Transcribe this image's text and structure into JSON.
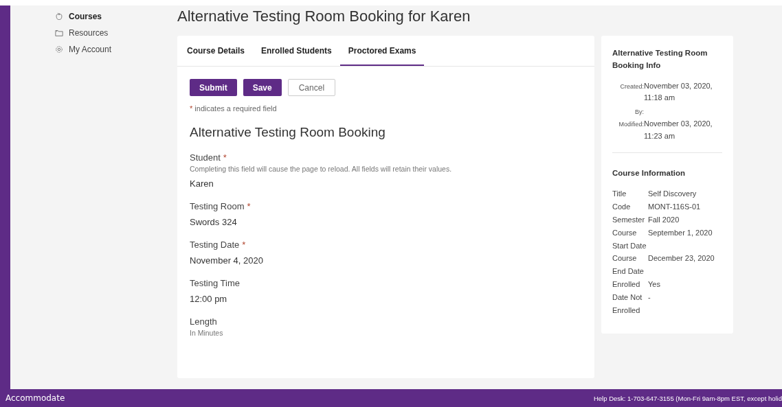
{
  "sidebar": {
    "items": [
      {
        "label": "Courses",
        "kind": "courses",
        "selected": true
      },
      {
        "label": "Resources",
        "kind": "resources",
        "selected": false
      },
      {
        "label": "My Account",
        "kind": "account",
        "selected": false
      }
    ]
  },
  "page_title": "Alternative Testing Room Booking for Karen",
  "tabs": [
    {
      "label": "Course Details",
      "selected": false
    },
    {
      "label": "Enrolled Students",
      "selected": false
    },
    {
      "label": "Proctored Exams",
      "selected": true
    }
  ],
  "buttons": [
    {
      "label": "Submit",
      "kind": "primary"
    },
    {
      "label": "Save",
      "kind": "primary"
    },
    {
      "label": "Cancel",
      "kind": "secondary"
    }
  ],
  "required_note": {
    "mark": "*",
    "text": "indicates a required field"
  },
  "form_title": "Alternative Testing Room Booking",
  "fields": [
    {
      "label": "Student",
      "required_mark": "*",
      "hint": "Completing this field will cause the page to reload. All fields will retain their values.",
      "value": "Karen"
    },
    {
      "label": "Testing Room",
      "required_mark": "*",
      "value": "Swords 324"
    },
    {
      "label": "Testing Date",
      "required_mark": "*",
      "value": "November 4, 2020"
    },
    {
      "label": "Testing Time",
      "value": "12:00 pm"
    },
    {
      "label": "Length",
      "hint": "In Minutes"
    }
  ],
  "info": {
    "title": "Alternative Testing Room Booking Info",
    "meta": [
      {
        "label": "Created:",
        "value": "November 03, 2020, 11:18 am"
      },
      {
        "label": "By:"
      },
      {
        "label": "Modified:",
        "value": "November 03, 2020, 11:23 am"
      }
    ]
  },
  "course_info": {
    "title": "Course Information",
    "rows": [
      {
        "label": "Title",
        "value": "Self Discovery"
      },
      {
        "label": "Code",
        "value": "MONT-116S-01"
      },
      {
        "label": "Semester",
        "value": "Fall 2020"
      },
      {
        "label": "Course Start Date",
        "value": "September 1, 2020"
      },
      {
        "label": "Course End Date",
        "value": "December 23, 2020"
      },
      {
        "label": "Enrolled",
        "value": "Yes"
      },
      {
        "label": "Date Not Enrolled",
        "value": "-"
      }
    ]
  },
  "footer": {
    "logo": "Accommodate",
    "help": "Help Desk: 1-703-647-3155 (Mon-Fri 9am-8pm EST, except holid"
  }
}
